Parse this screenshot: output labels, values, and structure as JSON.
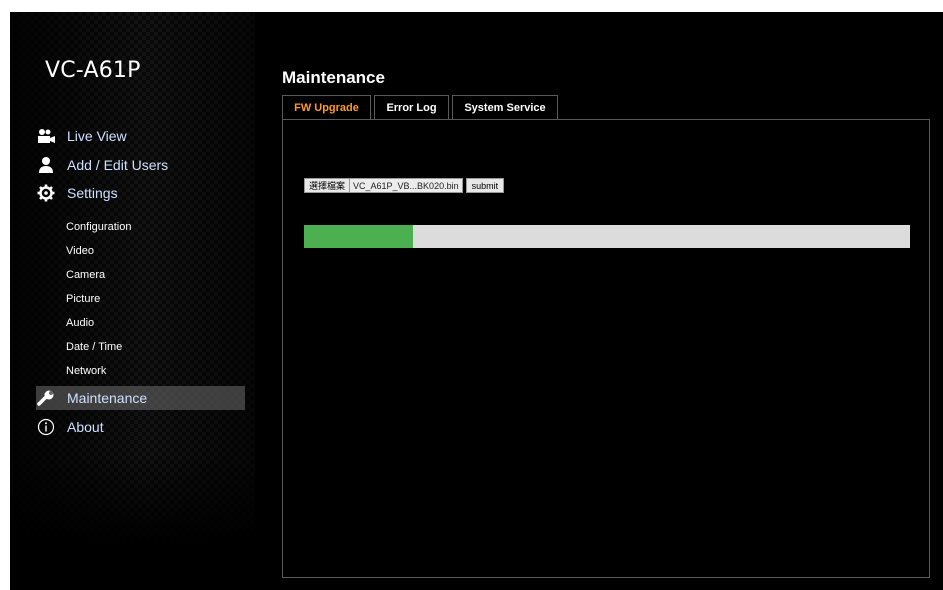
{
  "app": {
    "title": "VC-A61P"
  },
  "sidebar": {
    "main_items": [
      {
        "label": "Live View",
        "icon": "video-camera-icon"
      },
      {
        "label": "Add / Edit Users",
        "icon": "user-icon"
      },
      {
        "label": "Settings",
        "icon": "gear-icon"
      }
    ],
    "sub_items": [
      {
        "label": "Configuration"
      },
      {
        "label": "Video"
      },
      {
        "label": "Camera"
      },
      {
        "label": "Picture"
      },
      {
        "label": "Audio"
      },
      {
        "label": "Date / Time"
      },
      {
        "label": "Network"
      }
    ],
    "maintenance": {
      "label": "Maintenance",
      "icon": "wrench-icon",
      "active": true
    },
    "about": {
      "label": "About",
      "icon": "info-icon"
    }
  },
  "main": {
    "title": "Maintenance",
    "tabs": [
      {
        "label": "FW Upgrade",
        "active": true
      },
      {
        "label": "Error Log",
        "active": false
      },
      {
        "label": "System Service",
        "active": false
      }
    ],
    "fw_upgrade": {
      "choose_file_label": "選擇檔案",
      "file_name": "VC_A61P_VB...BK020.bin",
      "submit_label": "submit",
      "progress_percent": 18
    }
  },
  "colors": {
    "background": "#000000",
    "active_tab": "#ff9a1f",
    "progress_fill": "#4cb050",
    "progress_track": "#dcdcdc",
    "nav_text": "#cfe0ff"
  }
}
